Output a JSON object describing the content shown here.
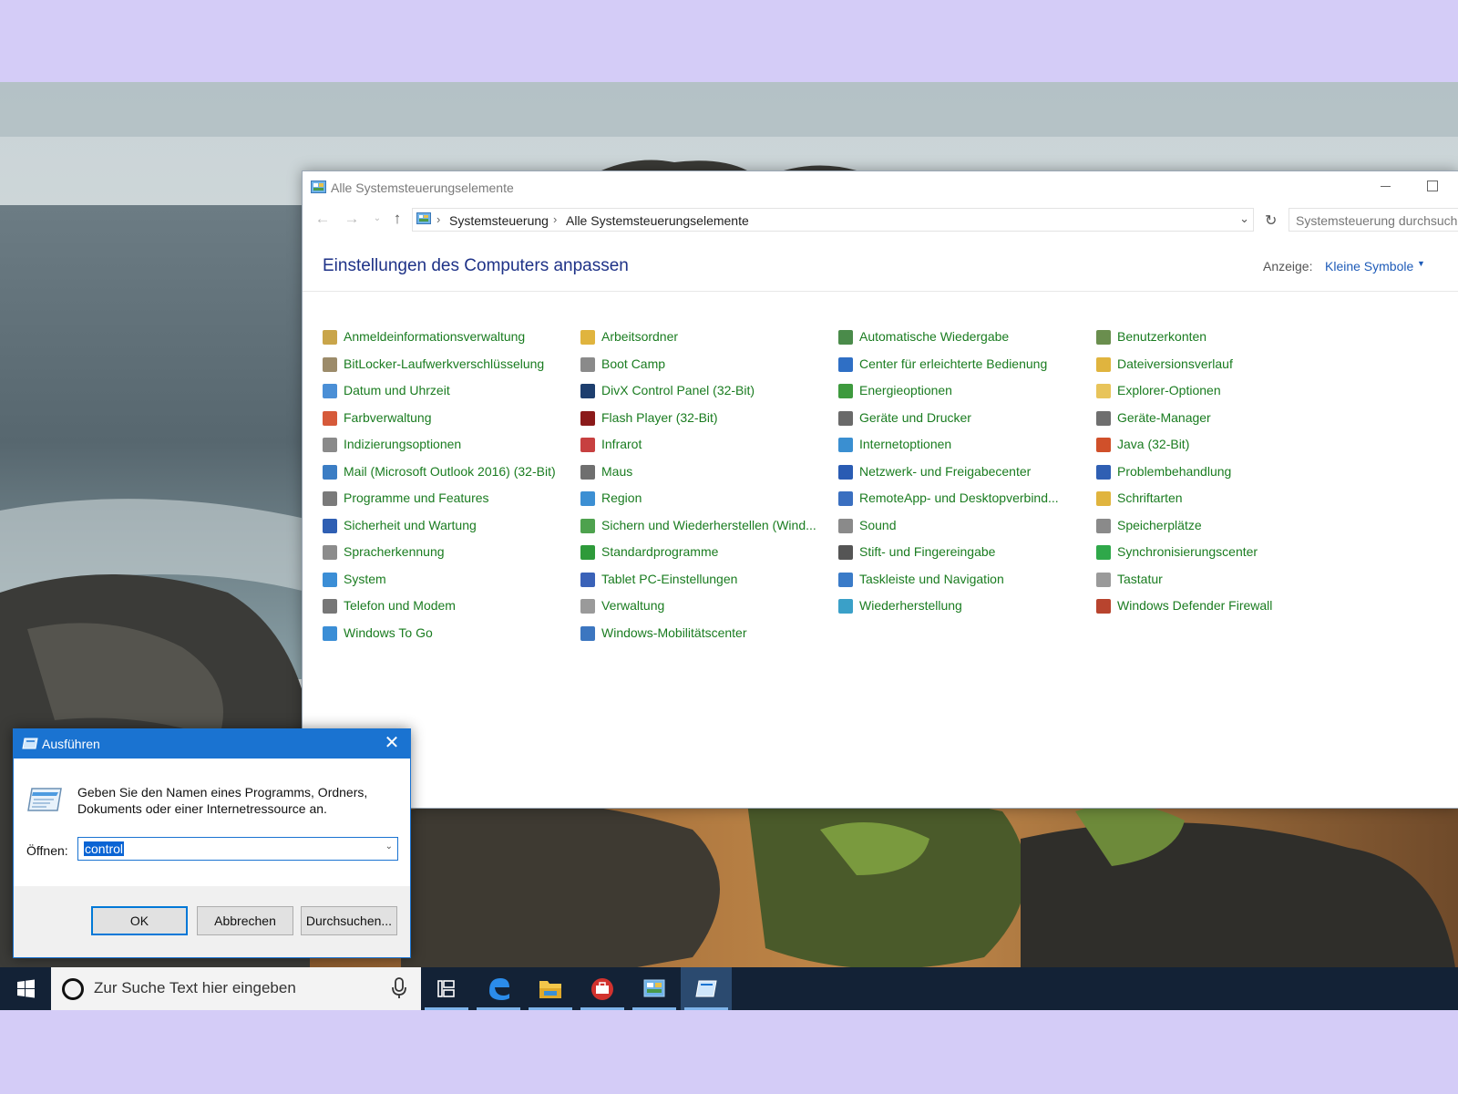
{
  "colors": {
    "accent": "#1a73d1",
    "link_green": "#1a7c20",
    "heading_blue": "#1e3287",
    "taskbar": "#132236",
    "page_background": "#d4ccf7"
  },
  "control_panel": {
    "title": "Alle Systemsteuerungselemente",
    "nav": {
      "back_icon": "arrow-left-icon",
      "forward_icon": "arrow-right-icon",
      "recent_icon": "chevron-down-icon",
      "up_icon": "arrow-up-icon"
    },
    "breadcrumb": [
      "Systemsteuerung",
      "Alle Systemsteuerungselemente"
    ],
    "search_placeholder": "Systemsteuerung durchsuchen",
    "heading": "Einstellungen des Computers anpassen",
    "view_label": "Anzeige:",
    "view_value": "Kleine Symbole",
    "columns": [
      [
        {
          "label": "Anmeldeinformationsverwaltung",
          "icon": "credential-vault-icon",
          "color": "#c9a54a"
        },
        {
          "label": "BitLocker-Laufwerkverschlüsselung",
          "icon": "bitlocker-key-icon",
          "color": "#9c8b6a"
        },
        {
          "label": "Datum und Uhrzeit",
          "icon": "calendar-clock-icon",
          "color": "#4b8fd6"
        },
        {
          "label": "Farbverwaltung",
          "icon": "color-management-icon",
          "color": "#d65a3a"
        },
        {
          "label": "Indizierungsoptionen",
          "icon": "indexing-icon",
          "color": "#8a8a8a"
        },
        {
          "label": "Mail (Microsoft Outlook 2016) (32-Bit)",
          "icon": "mail-icon",
          "color": "#3b7dc4"
        },
        {
          "label": "Programme und Features",
          "icon": "programs-icon",
          "color": "#7a7a7a"
        },
        {
          "label": "Sicherheit und Wartung",
          "icon": "flag-icon",
          "color": "#2f5fb3"
        },
        {
          "label": "Spracherkennung",
          "icon": "microphone-icon",
          "color": "#8c8c8c"
        },
        {
          "label": "System",
          "icon": "computer-icon",
          "color": "#3b8ed6"
        },
        {
          "label": "Telefon und Modem",
          "icon": "phone-icon",
          "color": "#777777"
        },
        {
          "label": "Windows To Go",
          "icon": "usb-drive-icon",
          "color": "#3b8ed6"
        }
      ],
      [
        {
          "label": "Arbeitsordner",
          "icon": "work-folder-icon",
          "color": "#e0b43e"
        },
        {
          "label": "Boot Camp",
          "icon": "boot-camp-icon",
          "color": "#8a8a8a"
        },
        {
          "label": "DivX Control Panel (32-Bit)",
          "icon": "divx-icon",
          "color": "#1d3e6e"
        },
        {
          "label": "Flash Player (32-Bit)",
          "icon": "flash-icon",
          "color": "#8b1a1a"
        },
        {
          "label": "Infrarot",
          "icon": "infrared-icon",
          "color": "#c74040"
        },
        {
          "label": "Maus",
          "icon": "mouse-icon",
          "color": "#6f6f6f"
        },
        {
          "label": "Region",
          "icon": "globe-clock-icon",
          "color": "#3c8fd3"
        },
        {
          "label": "Sichern und Wiederherstellen (Wind...",
          "icon": "backup-icon",
          "color": "#4ea24e"
        },
        {
          "label": "Standardprogramme",
          "icon": "default-programs-icon",
          "color": "#2e9a3a"
        },
        {
          "label": "Tablet PC-Einstellungen",
          "icon": "tablet-icon",
          "color": "#3a62b8"
        },
        {
          "label": "Verwaltung",
          "icon": "admin-tools-icon",
          "color": "#9a9a9a"
        },
        {
          "label": "Windows-Mobilitätscenter",
          "icon": "mobility-icon",
          "color": "#3c76c0"
        }
      ],
      [
        {
          "label": "Automatische Wiedergabe",
          "icon": "autoplay-icon",
          "color": "#4a8b4a"
        },
        {
          "label": "Center für erleichterte Bedienung",
          "icon": "accessibility-icon",
          "color": "#2f6fc5"
        },
        {
          "label": "Energieoptionen",
          "icon": "power-icon",
          "color": "#3e9a3e"
        },
        {
          "label": "Geräte und Drucker",
          "icon": "printer-icon",
          "color": "#6a6a6a"
        },
        {
          "label": "Internetoptionen",
          "icon": "internet-icon",
          "color": "#3a8fd1"
        },
        {
          "label": "Netzwerk- und Freigabecenter",
          "icon": "network-icon",
          "color": "#2a5cb3"
        },
        {
          "label": "RemoteApp- und Desktopverbind...",
          "icon": "remote-desktop-icon",
          "color": "#3a6fc0"
        },
        {
          "label": "Sound",
          "icon": "speaker-icon",
          "color": "#8a8a8a"
        },
        {
          "label": "Stift- und Fingereingabe",
          "icon": "pen-icon",
          "color": "#555555"
        },
        {
          "label": "Taskleiste und Navigation",
          "icon": "taskbar-icon",
          "color": "#3a7bc8"
        },
        {
          "label": "Wiederherstellung",
          "icon": "recovery-icon",
          "color": "#3aa0c8"
        }
      ],
      [
        {
          "label": "Benutzerkonten",
          "icon": "user-accounts-icon",
          "color": "#6a8e4e"
        },
        {
          "label": "Dateiversionsverlauf",
          "icon": "file-history-icon",
          "color": "#e0b43e"
        },
        {
          "label": "Explorer-Optionen",
          "icon": "folder-options-icon",
          "color": "#e8c45a"
        },
        {
          "label": "Geräte-Manager",
          "icon": "device-manager-icon",
          "color": "#6f6f6f"
        },
        {
          "label": "Java (32-Bit)",
          "icon": "java-icon",
          "color": "#d0502a"
        },
        {
          "label": "Problembehandlung",
          "icon": "troubleshoot-icon",
          "color": "#2f5fb3"
        },
        {
          "label": "Schriftarten",
          "icon": "fonts-icon",
          "color": "#e0b43e"
        },
        {
          "label": "Speicherplätze",
          "icon": "storage-spaces-icon",
          "color": "#8a8a8a"
        },
        {
          "label": "Synchronisierungscenter",
          "icon": "sync-icon",
          "color": "#2fa84a"
        },
        {
          "label": "Tastatur",
          "icon": "keyboard-icon",
          "color": "#9a9a9a"
        },
        {
          "label": "Windows Defender Firewall",
          "icon": "firewall-icon",
          "color": "#b8442e"
        }
      ]
    ]
  },
  "run_dialog": {
    "title": "Ausführen",
    "description": "Geben Sie den Namen eines Programms, Ordners, Dokuments oder einer Internetressource an.",
    "open_label": "Öffnen:",
    "input_value": "control",
    "buttons": {
      "ok": "OK",
      "cancel": "Abbrechen",
      "browse": "Durchsuchen..."
    }
  },
  "taskbar": {
    "search_placeholder": "Zur Suche Text hier eingeben",
    "apps": [
      {
        "icon": "task-view-icon",
        "active": false
      },
      {
        "icon": "edge-icon",
        "active": false
      },
      {
        "icon": "file-explorer-icon",
        "active": false
      },
      {
        "icon": "toolbox-app-icon",
        "active": false
      },
      {
        "icon": "control-panel-icon",
        "active": false
      },
      {
        "icon": "run-icon",
        "active": true
      }
    ]
  }
}
